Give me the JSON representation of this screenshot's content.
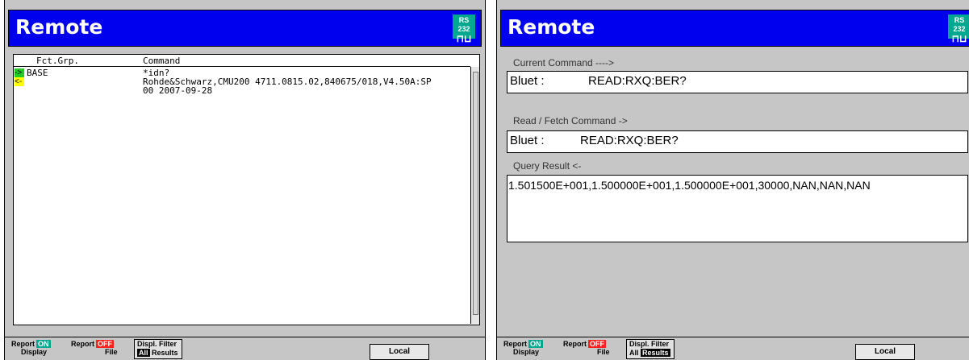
{
  "left": {
    "title": "Remote",
    "rs232_label": "RS 232",
    "rs232_glyph": "⊓⊔",
    "columns": {
      "fct_grp": "Fct.Grp.",
      "command": "Command"
    },
    "log": [
      {
        "arrow": "->",
        "group": "BASE",
        "lines": [
          "*idn?"
        ]
      },
      {
        "arrow": "<-",
        "group": "",
        "lines": [
          "Rohde&Schwarz,CMU200 4711.0815.02,840675/018,V4.50A:SP",
          "00 2007-09-28"
        ]
      }
    ]
  },
  "right": {
    "title": "Remote",
    "rs232_label": "RS 232",
    "rs232_glyph": "⊓⊔",
    "current_command_label": "Current Command ---->",
    "current_command": {
      "prefix": "Bluet :",
      "command": "READ:RXQ:BER?"
    },
    "read_fetch_label": "Read / Fetch Command ->",
    "read_fetch": {
      "prefix": "Bluet :",
      "command": "READ:RXQ:BER?"
    },
    "query_result_label": "Query Result <-",
    "query_result": "1.501500E+001,1.500000E+001,1.500000E+001,30000,NAN,NAN,NAN"
  },
  "softkeys": {
    "report_display_top": "Report",
    "report_display_bottom": "Display",
    "report_display_state": "ON",
    "report_file_top": "Report",
    "report_file_bottom": "File",
    "report_file_state": "OFF",
    "displ_filter_title": "Displ. Filter",
    "filter_all": "All",
    "filter_results": "Results",
    "local": "Local"
  },
  "colors": {
    "titlebar": "#0000ee",
    "panel_bg": "#c6c6c6",
    "rs232_badge": "#00a890",
    "arrow_out": "#22cc22",
    "arrow_in": "#ffff00"
  }
}
